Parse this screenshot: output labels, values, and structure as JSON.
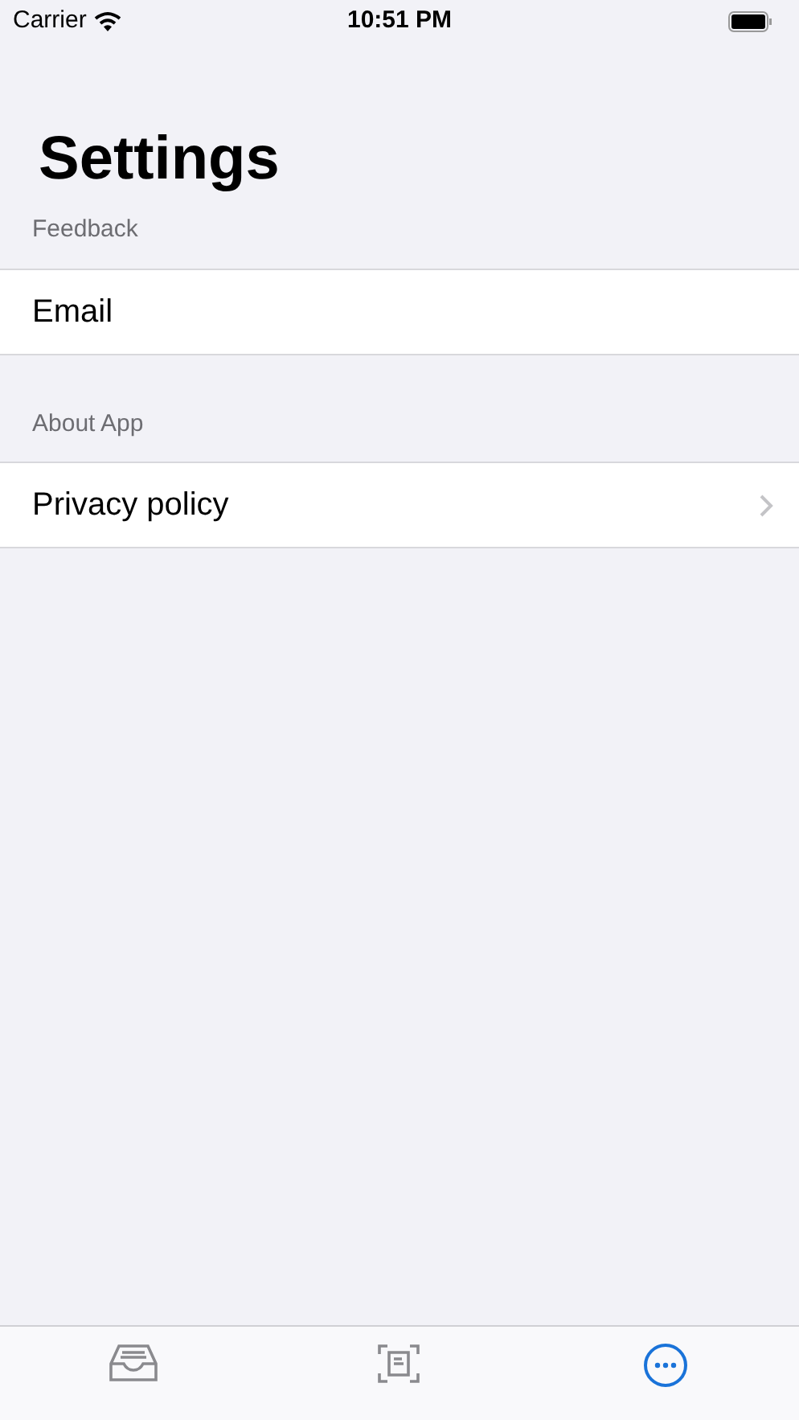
{
  "status_bar": {
    "carrier": "Carrier",
    "time": "10:51 PM"
  },
  "title": "Settings",
  "sections": [
    {
      "header": "Feedback",
      "rows": [
        {
          "label": "Email",
          "chevron": false
        }
      ]
    },
    {
      "header": "About App",
      "rows": [
        {
          "label": "Privacy policy",
          "chevron": true
        }
      ]
    }
  ],
  "tab_bar": [
    {
      "kind": "inbox",
      "selected": false
    },
    {
      "kind": "scan",
      "selected": false
    },
    {
      "kind": "more",
      "selected": true
    }
  ]
}
